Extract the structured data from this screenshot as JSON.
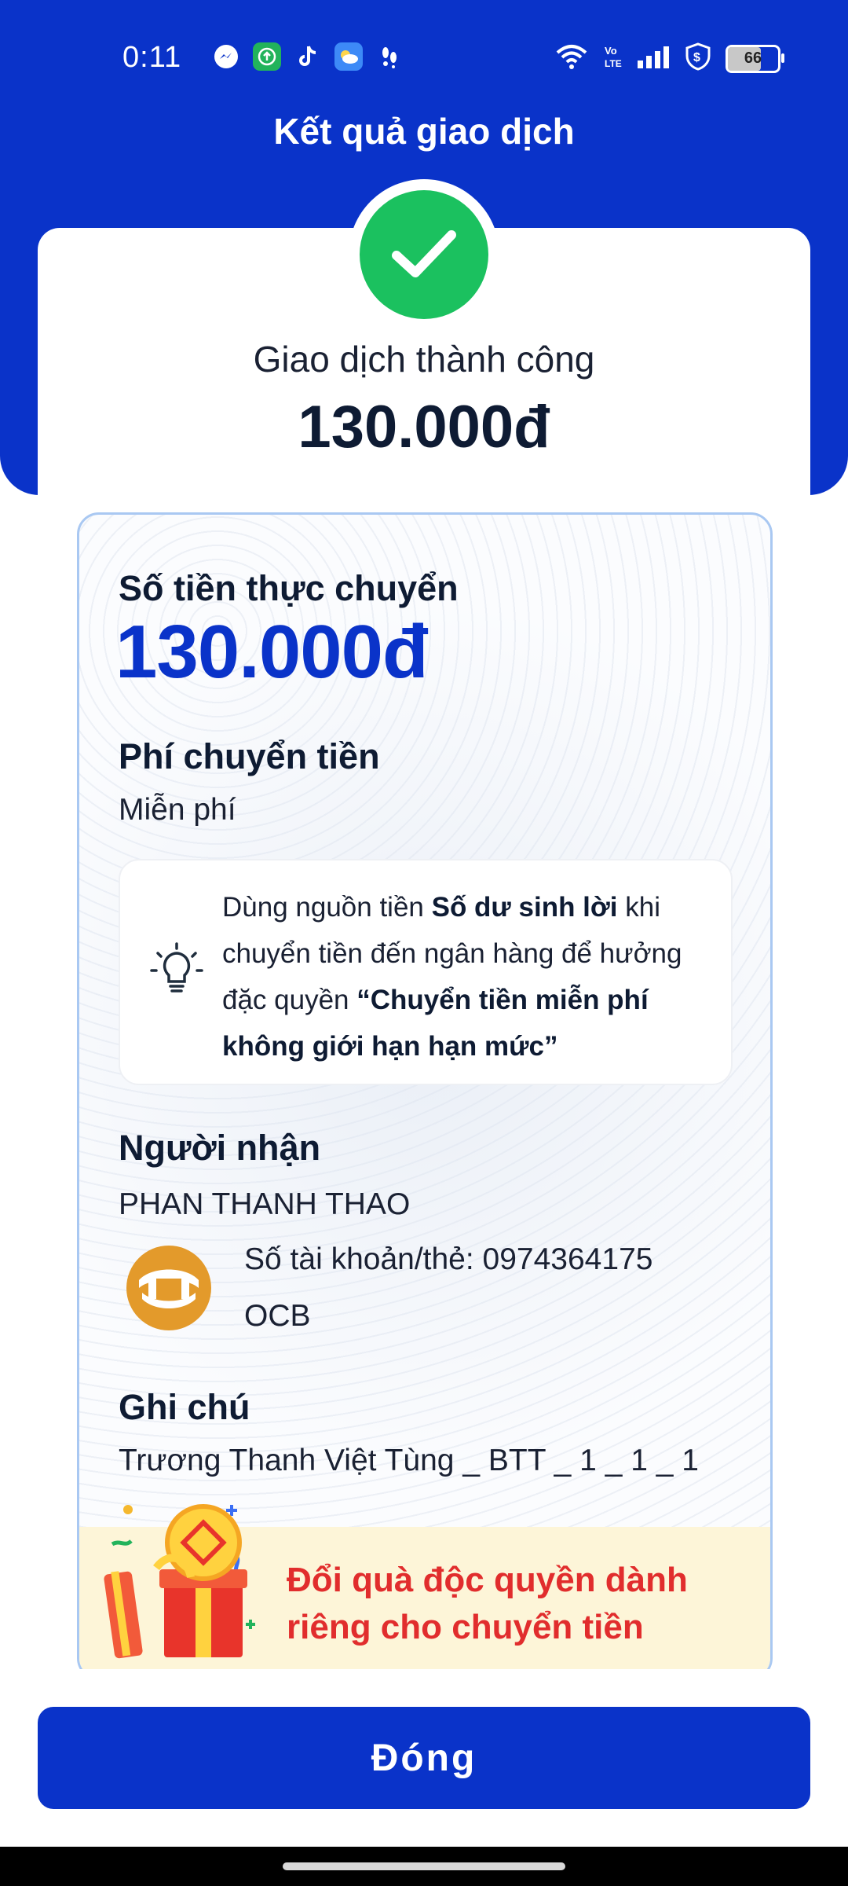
{
  "status_bar": {
    "time": "0:11",
    "battery": "66",
    "app_icons": [
      "messenger-icon",
      "upload-app-icon",
      "tiktok-icon",
      "weather-icon",
      "footprints-icon"
    ],
    "system_icons": [
      "wifi-icon",
      "volte-icon",
      "signal-icon",
      "vpn-shield-icon",
      "battery-icon"
    ]
  },
  "header": {
    "title": "Kết quả giao dịch"
  },
  "result": {
    "status": "Giao dịch thành công",
    "amount": "130.000đ"
  },
  "details": {
    "actual_amount_label": "Số tiền thực chuyển",
    "actual_amount": "130.000đ",
    "fee_label": "Phí chuyển tiền",
    "fee_value": "Miễn phí",
    "tip": {
      "part1": "Dùng nguồn tiền ",
      "bold1": "Số dư sinh lời",
      "part2": " khi chuyển tiền đến ngân hàng để hưởng đặc quyền ",
      "bold2": "“Chuyển tiền miễn phí không giới hạn hạn mức”"
    },
    "recipient_label": "Người nhận",
    "recipient_name": "PHAN THANH THAO",
    "account_line": "Số tài khoản/thẻ: 0974364175",
    "bank_name": "OCB",
    "note_label": "Ghi chú",
    "note_value": "Trương Thanh Việt Tùng _ BTT _ 1 _ 1 _ 1"
  },
  "promo": {
    "text": "Đổi quà độc quyền dành riêng cho chuyển tiền"
  },
  "actions": {
    "close_label": "Đóng"
  },
  "colors": {
    "brand_blue": "#0a33c9",
    "success_green": "#1bc15f",
    "promo_red": "#e12d2d",
    "promo_bg": "#fdf5d8",
    "bank_orange": "#e39a2b"
  }
}
